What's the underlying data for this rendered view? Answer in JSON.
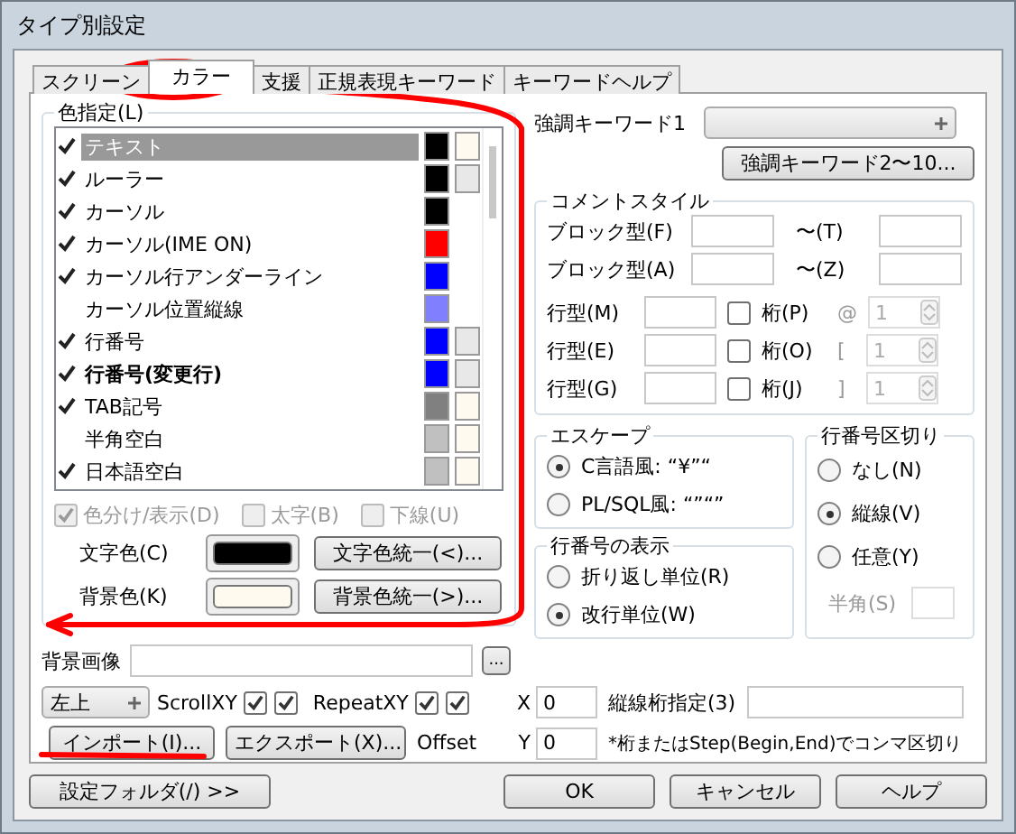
{
  "window": {
    "title": "タイプ別設定"
  },
  "tabs": [
    {
      "label": "スクリーン",
      "selected": false
    },
    {
      "label": "カラー",
      "selected": true
    },
    {
      "label": "支援",
      "selected": false
    },
    {
      "label": "正規表現キーワード",
      "selected": false
    },
    {
      "label": "キーワードヘルプ",
      "selected": false
    }
  ],
  "color_group": {
    "title": "色指定(L)",
    "items": [
      {
        "label": "テキスト",
        "checked": true,
        "selected": true,
        "bold": false,
        "swatches": [
          {
            "color": "#000000"
          },
          {
            "color": "#fffaf0"
          }
        ]
      },
      {
        "label": "ルーラー",
        "checked": true,
        "selected": false,
        "bold": false,
        "swatches": [
          {
            "color": "#000000"
          },
          {
            "color": "#e8e8e8"
          }
        ]
      },
      {
        "label": "カーソル",
        "checked": true,
        "selected": false,
        "bold": false,
        "swatches": [
          {
            "color": "#000000"
          }
        ]
      },
      {
        "label": "カーソル(IME ON)",
        "checked": true,
        "selected": false,
        "bold": false,
        "swatches": [
          {
            "color": "#ff0000"
          }
        ]
      },
      {
        "label": "カーソル行アンダーライン",
        "checked": true,
        "selected": false,
        "bold": false,
        "swatches": [
          {
            "color": "#0000ff"
          }
        ]
      },
      {
        "label": "カーソル位置縦線",
        "checked": false,
        "selected": false,
        "bold": false,
        "swatches": [
          {
            "color": "#8080ff"
          }
        ]
      },
      {
        "label": "行番号",
        "checked": true,
        "selected": false,
        "bold": false,
        "swatches": [
          {
            "color": "#0000ff"
          },
          {
            "color": "#e8e8e8"
          }
        ]
      },
      {
        "label": "行番号(変更行)",
        "checked": true,
        "selected": false,
        "bold": true,
        "swatches": [
          {
            "color": "#0000ff"
          },
          {
            "color": "#e8e8e8"
          }
        ]
      },
      {
        "label": "TAB記号",
        "checked": true,
        "selected": false,
        "bold": false,
        "swatches": [
          {
            "color": "#808080"
          },
          {
            "color": "#fffaf0"
          }
        ]
      },
      {
        "label": "半角空白",
        "checked": false,
        "selected": false,
        "bold": false,
        "swatches": [
          {
            "color": "#c0c0c0"
          },
          {
            "color": "#fffaf0"
          }
        ]
      },
      {
        "label": "日本語空白",
        "checked": true,
        "selected": false,
        "bold": false,
        "swatches": [
          {
            "color": "#c0c0c0"
          },
          {
            "color": "#fffaf0"
          }
        ]
      }
    ],
    "options": [
      {
        "label": "色分け/表示(D)",
        "checked": true,
        "disabled": true
      },
      {
        "label": "太字(B)",
        "checked": false,
        "disabled": true
      },
      {
        "label": "下線(U)",
        "checked": false,
        "disabled": true
      }
    ],
    "text_color": {
      "label": "文字色(C)",
      "color": "#000000",
      "button": "文字色統一(<)..."
    },
    "back_color": {
      "label": "背景色(K)",
      "color": "#fffaf0",
      "button": "背景色統一(>)..."
    }
  },
  "keyword": {
    "label": "強調キーワード1",
    "button": "強調キーワード2〜10..."
  },
  "comment_group": {
    "title": "コメントスタイル",
    "blocks": [
      {
        "label": "ブロック型(F)",
        "to_label": "〜(T)"
      },
      {
        "label": "ブロック型(A)",
        "to_label": "〜(Z)"
      }
    ],
    "lines": [
      {
        "label": "行型(M)",
        "column_label": "桁(P)",
        "checked": false,
        "symbol": "@",
        "value": "1"
      },
      {
        "label": "行型(E)",
        "column_label": "桁(O)",
        "checked": false,
        "symbol": "[",
        "value": "1"
      },
      {
        "label": "行型(G)",
        "column_label": "桁(J)",
        "checked": false,
        "symbol": "]",
        "value": "1"
      }
    ]
  },
  "escape_group": {
    "title": "エスケープ",
    "options": [
      {
        "label": "C言語風: “¥”“",
        "selected": true
      },
      {
        "label": "PL/SQL風: “”“”",
        "selected": false
      }
    ]
  },
  "line_number_group": {
    "title": "行番号の表示",
    "options": [
      {
        "label": "折り返し単位(R)",
        "selected": false
      },
      {
        "label": "改行単位(W)",
        "selected": true
      }
    ]
  },
  "separator_group": {
    "title": "行番号区切り",
    "options": [
      {
        "label": "なし(N)",
        "selected": false
      },
      {
        "label": "縦線(V)",
        "selected": true
      },
      {
        "label": "任意(Y)",
        "selected": false
      }
    ],
    "width_label": "半角(S)"
  },
  "background_image": {
    "label": "背景画像",
    "browse": "...",
    "position": "左上",
    "scroll_label": "ScrollXY",
    "scroll": [
      true,
      true
    ],
    "repeat_label": "RepeatXY",
    "repeat": [
      true,
      true
    ],
    "offset_label": "Offset",
    "x_label": "X",
    "x_value": "0",
    "y_label": "Y",
    "y_value": "0"
  },
  "vertical_lines": {
    "label": "縦線桁指定(3)",
    "note": "*桁またはStep(Begin,End)でコンマ区切り"
  },
  "import_button": "インポート(I)...",
  "export_button": "エクスポート(X)...",
  "footer": {
    "folder_button": "設定フォルダ(/) >>",
    "buttons": [
      "OK",
      "キャンセル",
      "ヘルプ"
    ]
  }
}
